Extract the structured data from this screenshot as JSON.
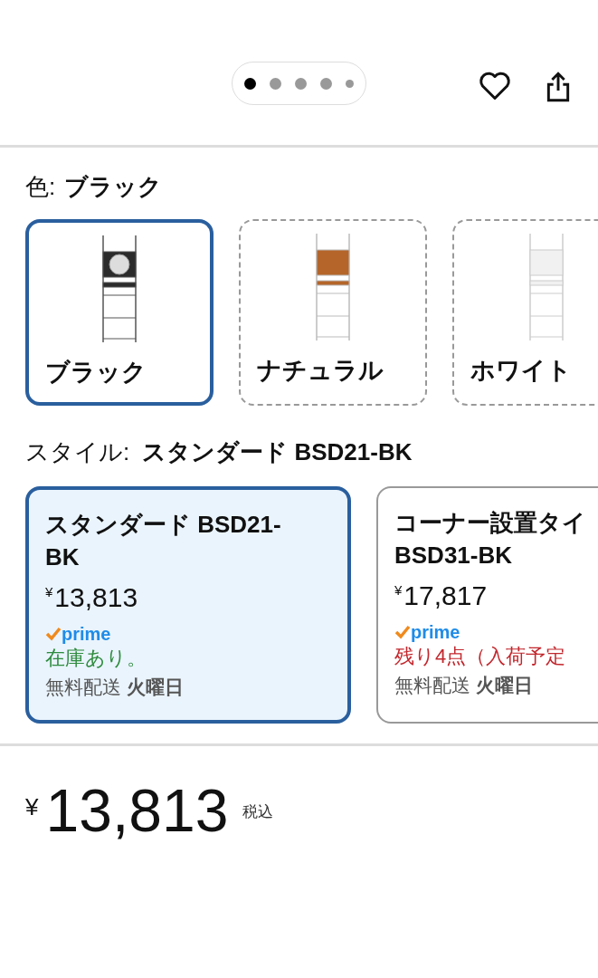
{
  "carousel": {
    "dots": [
      {
        "selected": true
      },
      {
        "selected": false
      },
      {
        "selected": false
      },
      {
        "selected": false
      },
      {
        "selected": false
      }
    ]
  },
  "color": {
    "label": "色:",
    "value": "ブラック",
    "options": [
      {
        "name": "ブラック",
        "selected": true,
        "available": true,
        "kind": "black"
      },
      {
        "name": "ナチュラル",
        "selected": false,
        "available": false,
        "kind": "natural"
      },
      {
        "name": "ホワイト",
        "selected": false,
        "available": false,
        "kind": "white"
      }
    ]
  },
  "style": {
    "label": "スタイル:",
    "value": "スタンダード BSD21-BK",
    "options": [
      {
        "name": "スタンダード BSD21-BK",
        "selected": true,
        "currency": "¥",
        "amount": "13,813",
        "prime": "prime",
        "availability": {
          "text": "在庫あり。",
          "kind": "in_stock"
        },
        "delivery": "無料配送 **火曜日**"
      },
      {
        "name": "コーナー設置タイ BSD31-BK",
        "selected": false,
        "currency": "¥",
        "amount": "17,817",
        "prime": "prime",
        "availability": {
          "text": "残り4点（入荷予定",
          "kind": "low_stock"
        },
        "delivery": "無料配送 **火曜日**"
      }
    ]
  },
  "price": {
    "currency": "¥",
    "amount": "13,813",
    "tax_note": "税込"
  }
}
